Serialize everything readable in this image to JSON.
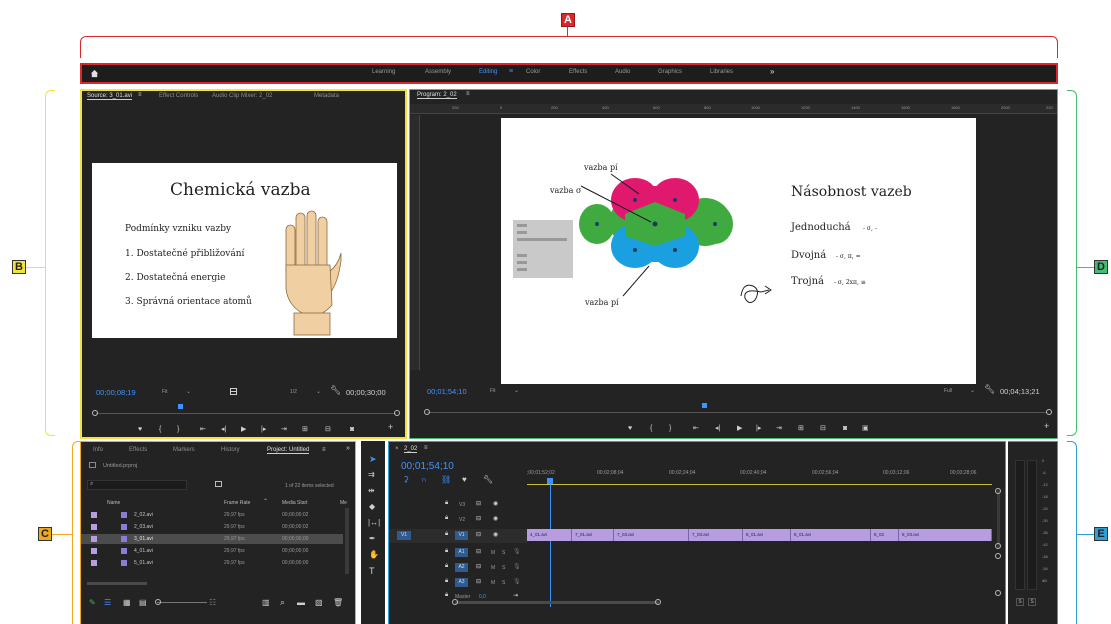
{
  "callouts": {
    "a": "A",
    "b": "B",
    "c": "C",
    "d": "D",
    "e": "E"
  },
  "workspaces": {
    "items": [
      "Learning",
      "Assembly",
      "Editing",
      "Color",
      "Effects",
      "Audio",
      "Graphics",
      "Libraries"
    ],
    "more": "»",
    "active": "Editing"
  },
  "source": {
    "tabs": [
      "Source: 3_01.avi",
      "Effect Controls",
      "Audio Clip Mixer: 2_02",
      "Metadata"
    ],
    "timecode": "00;00;08;19",
    "fit": "Fit",
    "ratio": "1/2",
    "duration": "00;00;30;00",
    "slide": {
      "title": "Chemická vazba",
      "subtitle": "Podmínky vzniku vazby",
      "items": [
        "1. Dostatečné přibližování",
        "2. Dostatečná energie",
        "3. Správná orientace atomů"
      ]
    }
  },
  "program": {
    "tab": "Program: 2_02",
    "ruler": [
      "200",
      "0",
      "200",
      "400",
      "600",
      "800",
      "1000",
      "1200",
      "1400",
      "1600",
      "1800",
      "2000",
      "220"
    ],
    "timecode": "00;01;54;10",
    "fit": "Fit",
    "quality": "Full",
    "duration": "00;04;13;21",
    "slide": {
      "label_top": "vazba pí",
      "label_sigma": "vazba σ",
      "label_bottom": "vazba pí",
      "title": "Násobnost vazeb",
      "lines": [
        {
          "word": "Jednoduchá",
          "suffix": "- σ, -"
        },
        {
          "word": "Dvojná",
          "suffix": "- σ, π, ="
        },
        {
          "word": "Trojná",
          "suffix": "- σ, 2xπ, ≡"
        }
      ]
    }
  },
  "project": {
    "tabs": [
      "Info",
      "Effects",
      "Markers",
      "History",
      "Project: Untitled"
    ],
    "more": "»",
    "file": "Untitled.prproj",
    "items_selected": "1 of 22 items selected",
    "columns": [
      "Name",
      "Frame Rate",
      "Media Start",
      "Me"
    ],
    "rows": [
      {
        "name": "2_02.avi",
        "rate": "29,97 fps",
        "start": "00;00;00;02"
      },
      {
        "name": "2_03.avi",
        "rate": "29,97 fps",
        "start": "00;00;00;02"
      },
      {
        "name": "3_01.avi",
        "rate": "29,97 fps",
        "start": "00;00;00;00"
      },
      {
        "name": "4_01.avi",
        "rate": "29,97 fps",
        "start": "00;00;00;00"
      },
      {
        "name": "5_01.avi",
        "rate": "29,97 fps",
        "start": "00;00;00;00"
      }
    ]
  },
  "timeline": {
    "tab": "2_02",
    "timecode": "00;01;54;10",
    "ruler": [
      ";00;01;52;02",
      "00;02;08;04",
      "00;02;24;04",
      "00;02;40;04",
      "00;02;56;04",
      "00;03;12;06",
      "00;03;28;06"
    ],
    "video_tracks": [
      "V3",
      "V2",
      "V1"
    ],
    "audio_tracks": [
      "A1",
      "A2",
      "A3"
    ],
    "source_patch": "V1",
    "master": "Master",
    "master_value": "0,0",
    "clips": [
      "4_01.avi",
      "7_01.avi",
      "7_03.avi",
      "7_03.avi",
      "8_01.avi",
      "8_01.avi",
      "8_02",
      "8_03.avi"
    ]
  },
  "meter": {
    "scale": [
      "0",
      "-6",
      "-12",
      "-18",
      "-24",
      "-30",
      "-36",
      "-42",
      "-48",
      "-54",
      "dB"
    ],
    "solo": [
      "S",
      "S"
    ]
  },
  "colors": {
    "accent": "#3f93ff",
    "callout_a": "#d8282c",
    "callout_b": "#f2e33c",
    "callout_c": "#f2a81d",
    "callout_d": "#3fbf6f",
    "callout_e": "#2e9fd8",
    "pi_pink": "#e0196f",
    "sigma_green": "#3faa3f",
    "pi_blue": "#1a9fe0",
    "clip": "#b59de0"
  }
}
